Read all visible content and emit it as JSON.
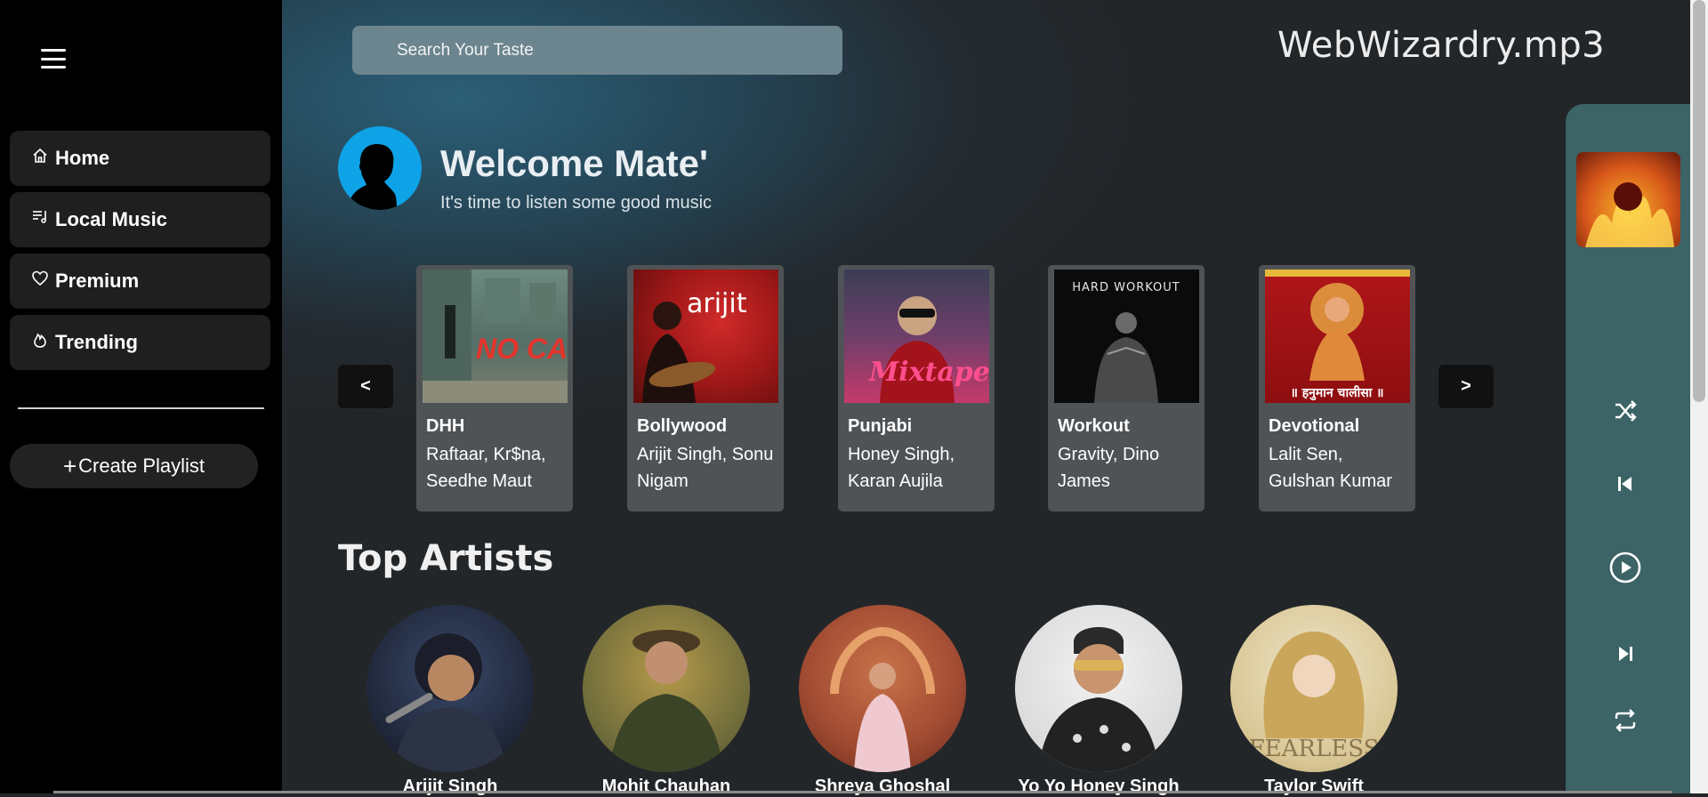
{
  "sidebar": {
    "items": [
      {
        "label": "Home",
        "icon": "home-icon"
      },
      {
        "label": "Local Music",
        "icon": "playlist-icon"
      },
      {
        "label": "Premium",
        "icon": "heart-icon"
      },
      {
        "label": "Trending",
        "icon": "flame-icon"
      }
    ],
    "create_playlist_label": "Create Playlist"
  },
  "header": {
    "search_placeholder": "Search Your Taste",
    "brand": "WebWizardry.mp3"
  },
  "welcome": {
    "title": "Welcome Mate'",
    "subtitle": "It's time to listen some good music"
  },
  "carousel": {
    "prev_label": "<",
    "next_label": ">",
    "cards": [
      {
        "title": "DHH",
        "artists": "Raftaar, Kr$na, Seedhe Maut",
        "cover_text": "NO CAP"
      },
      {
        "title": "Bollywood",
        "artists": "Arijit Singh, Sonu Nigam",
        "cover_text": "arijit"
      },
      {
        "title": "Punjabi",
        "artists": "Honey Singh, Karan Aujila",
        "cover_text": "Mixtape"
      },
      {
        "title": "Workout",
        "artists": "Gravity, Dino James",
        "cover_text": "HARD WORKOUT"
      },
      {
        "title": "Devotional",
        "artists": "Lalit Sen, Gulshan Kumar",
        "cover_text": "॥ हनुमान चालीसा ॥"
      }
    ]
  },
  "top_artists": {
    "title": "Top Artists",
    "artists": [
      {
        "name": "Arijit Singh"
      },
      {
        "name": "Mohit Chauhan"
      },
      {
        "name": "Shreya Ghoshal"
      },
      {
        "name": "Yo Yo Honey Singh"
      },
      {
        "name": "Taylor Swift"
      }
    ]
  },
  "player": {
    "controls": [
      "shuffle-icon",
      "previous-icon",
      "play-icon",
      "next-icon",
      "repeat-icon"
    ]
  },
  "colors": {
    "sidebar_bg": "#000000",
    "nav_item_bg": "#1f1f1f",
    "card_bg": "#4f5356",
    "player_bg": "#3c6366",
    "search_bg": "#6c858f",
    "avatar_bg": "#0ea2e6"
  }
}
